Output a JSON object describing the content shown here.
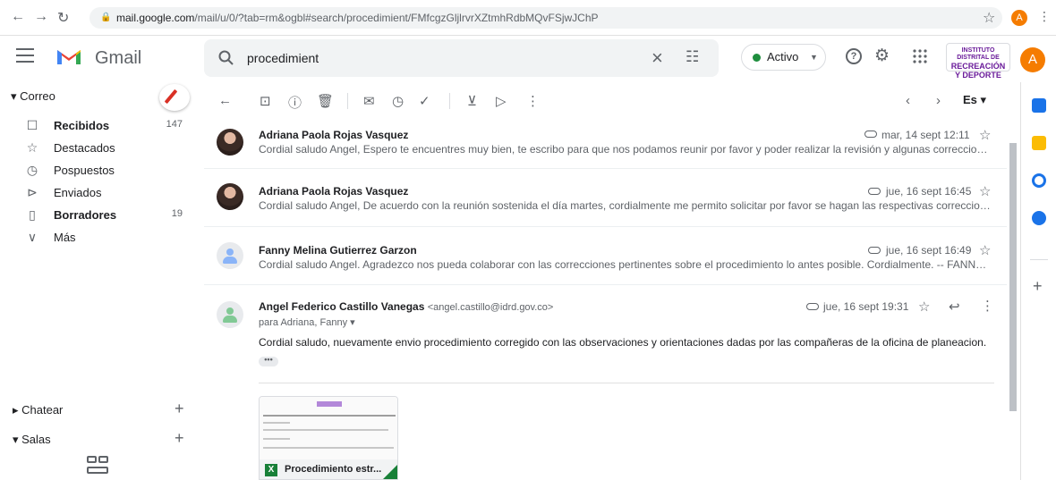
{
  "browser": {
    "url_host": "mail.google.com",
    "url_rest": "/mail/u/0/?tab=rm&ogbl#search/procedimient/FMfcgzGljlrvrXZtmhRdbMQvFSjwJChP",
    "profile_initial": "A"
  },
  "header": {
    "app_name": "Gmail",
    "search_value": "procedimient",
    "status_label": "Activo",
    "org_logo_line1": "INSTITUTO DISTRITAL DE",
    "org_logo_line2": "RECREACIÓN",
    "org_logo_line3": "Y DEPORTE",
    "avatar_initial": "A"
  },
  "sidebar": {
    "section_title": "Correo",
    "items": [
      {
        "label": "Recibidos",
        "count": "147",
        "icon": "inbox-icon"
      },
      {
        "label": "Destacados",
        "count": "",
        "icon": "star-icon"
      },
      {
        "label": "Pospuestos",
        "count": "",
        "icon": "clock-icon"
      },
      {
        "label": "Enviados",
        "count": "",
        "icon": "send-icon"
      },
      {
        "label": "Borradores",
        "count": "19",
        "icon": "draft-icon"
      },
      {
        "label": "Más",
        "count": "",
        "icon": "chevron-down-icon"
      }
    ],
    "chat_title": "Chatear",
    "rooms_title": "Salas"
  },
  "toolbar": {
    "language": "Es"
  },
  "messages": [
    {
      "sender": "Adriana Paola Rojas Vasquez",
      "snippet": "Cordial saludo Angel, Espero te encuentres muy bien, te escribo para que nos podamos reunir por favor y poder realizar la revisión y algunas correcciones al...",
      "date": "mar, 14 sept 12:11"
    },
    {
      "sender": "Adriana Paola Rojas Vasquez",
      "snippet": "Cordial saludo Angel, De acuerdo con la reunión sostenida el día martes, cordialmente me permito solicitar por favor se hagan las respectivas correcciones q...",
      "date": "jue, 16 sept 16:45"
    },
    {
      "sender": "Fanny Melina Gutierrez Garzon",
      "snippet": "Cordial saludo Angel. Agradezco nos pueda colaborar con las correcciones pertinentes sobre el procedimiento lo antes posible. Cordialmente. -- FANNY ME...",
      "date": "jue, 16 sept 16:49"
    }
  ],
  "open_message": {
    "sender": "Angel Federico Castillo Vanegas",
    "email": "<angel.castillo@idrd.gov.co>",
    "to_line": "para Adriana, Fanny",
    "date": "jue, 16 sept 19:31",
    "body": "Cordial saludo, nuevamente envio procedimiento corregido con las observaciones y orientaciones dadas por las compañeras de la oficina de planeacion.",
    "attachment_name": "Procedimiento estr..."
  }
}
